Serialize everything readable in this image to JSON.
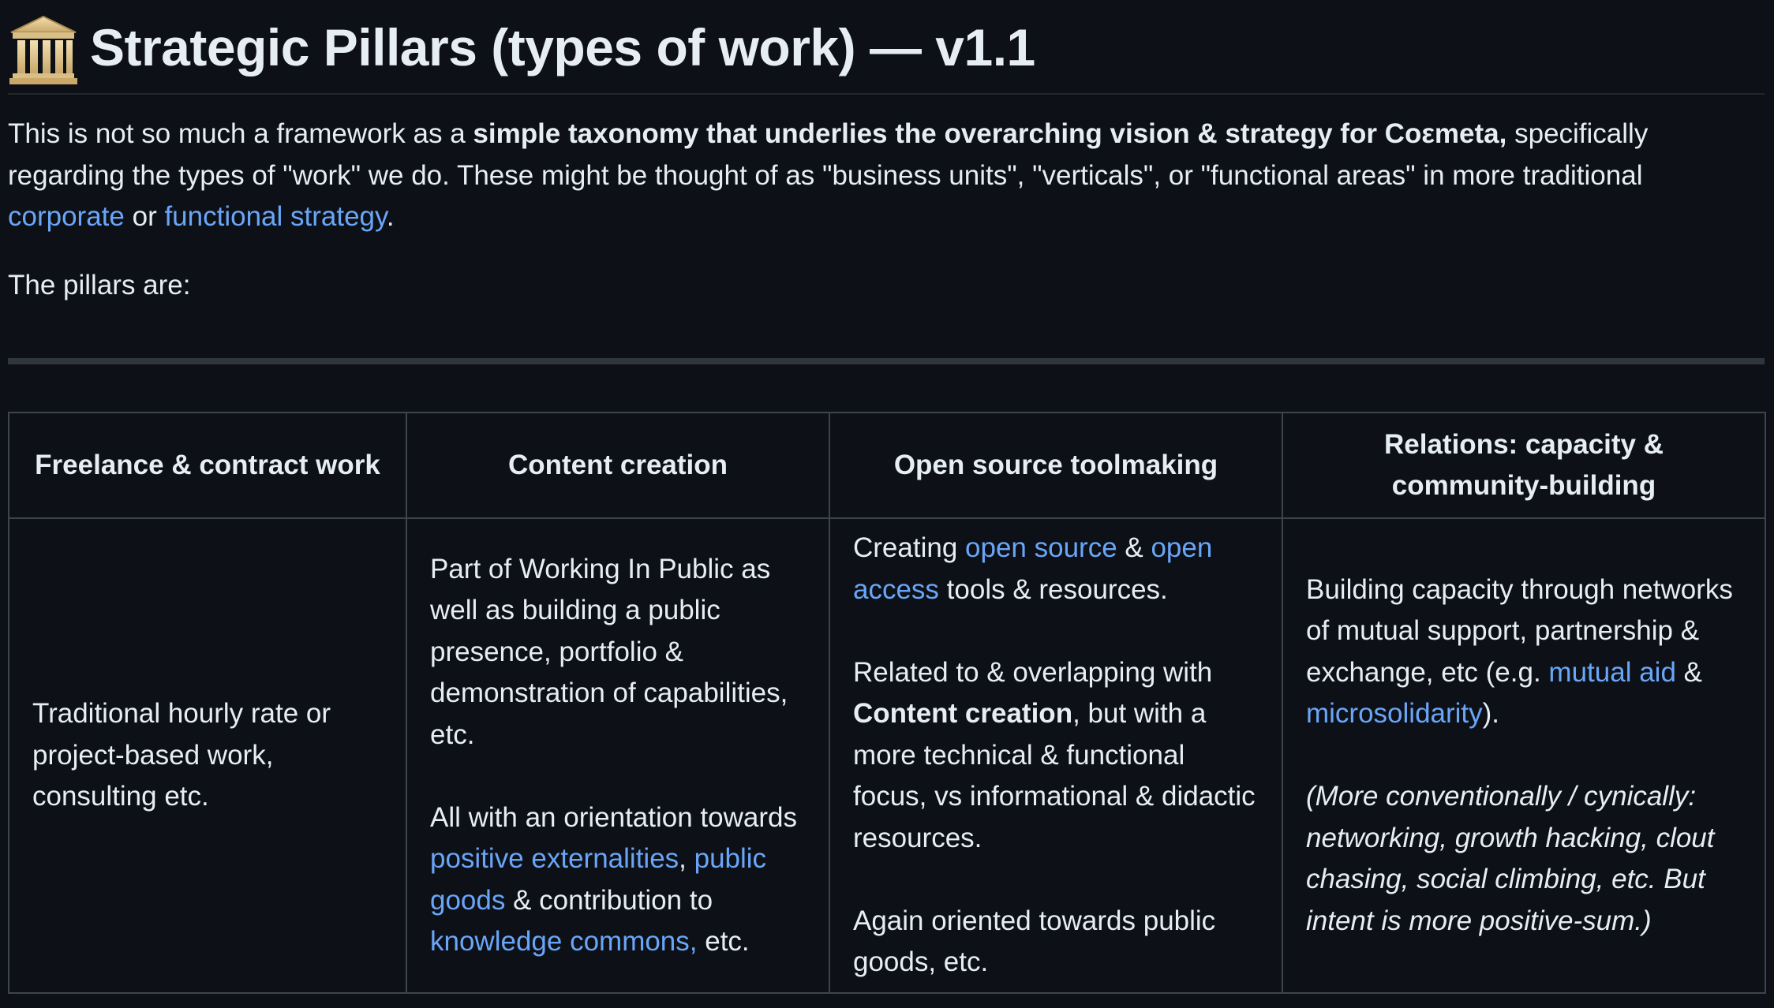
{
  "heading": {
    "icon": "classical-building-icon",
    "title": "Strategic Pillars (types of work) — v1.1"
  },
  "intro": {
    "part1": "This is not so much a framework as a ",
    "bold": "simple taxonomy that underlies the overarching vision & strategy for Coεmeta,",
    "part2": " specifically regarding the types of \"work\" we do. These might be thought of as \"business units\", \"verticals\", or \"functional areas\" in more traditional ",
    "link_corporate": "corporate",
    "part3": " or ",
    "link_functional": "functional strategy",
    "part4": "."
  },
  "pillars_label": "The pillars are:",
  "table": {
    "headers": [
      "Freelance & contract work",
      "Content creation",
      "Open source toolmaking",
      "Relations: capacity & community-building"
    ],
    "col1": {
      "text": "Traditional hourly rate or project-based work, consulting etc."
    },
    "col2": {
      "p1": "Part of Working In Public as well as building a public presence, portfolio & demonstration of capabilities, etc.",
      "p2_a": "All with an orientation towards ",
      "p2_link1": "positive externalities",
      "p2_b": ", ",
      "p2_link2": "public goods",
      "p2_c": " & contribution to ",
      "p2_link3": "knowledge commons,",
      "p2_d": " etc."
    },
    "col3": {
      "p1_a": "Creating ",
      "p1_link1": "open source",
      "p1_b": " & ",
      "p1_link2": "open access",
      "p1_c": " tools & resources.",
      "p2_a": "Related to & overlapping with ",
      "p2_bold": "Content creation",
      "p2_b": ", but with a more technical & functional focus, vs informational & didactic resources.",
      "p3": "Again oriented towards public goods, etc."
    },
    "col4": {
      "p1_a": "Building capacity through networks of mutual support, partnership & exchange, etc (e.g. ",
      "p1_link1": "mutual aid",
      "p1_b": " & ",
      "p1_link2": "microsolidarity",
      "p1_c": ").",
      "p2_italic": "(More conventionally / cynically: networking, growth hacking, clout chasing, social climbing, etc. But intent is more positive-sum.)"
    }
  },
  "colors": {
    "background": "#0d1117",
    "text": "#e6edf3",
    "link": "#6aa6f8",
    "border": "#3d444d"
  }
}
